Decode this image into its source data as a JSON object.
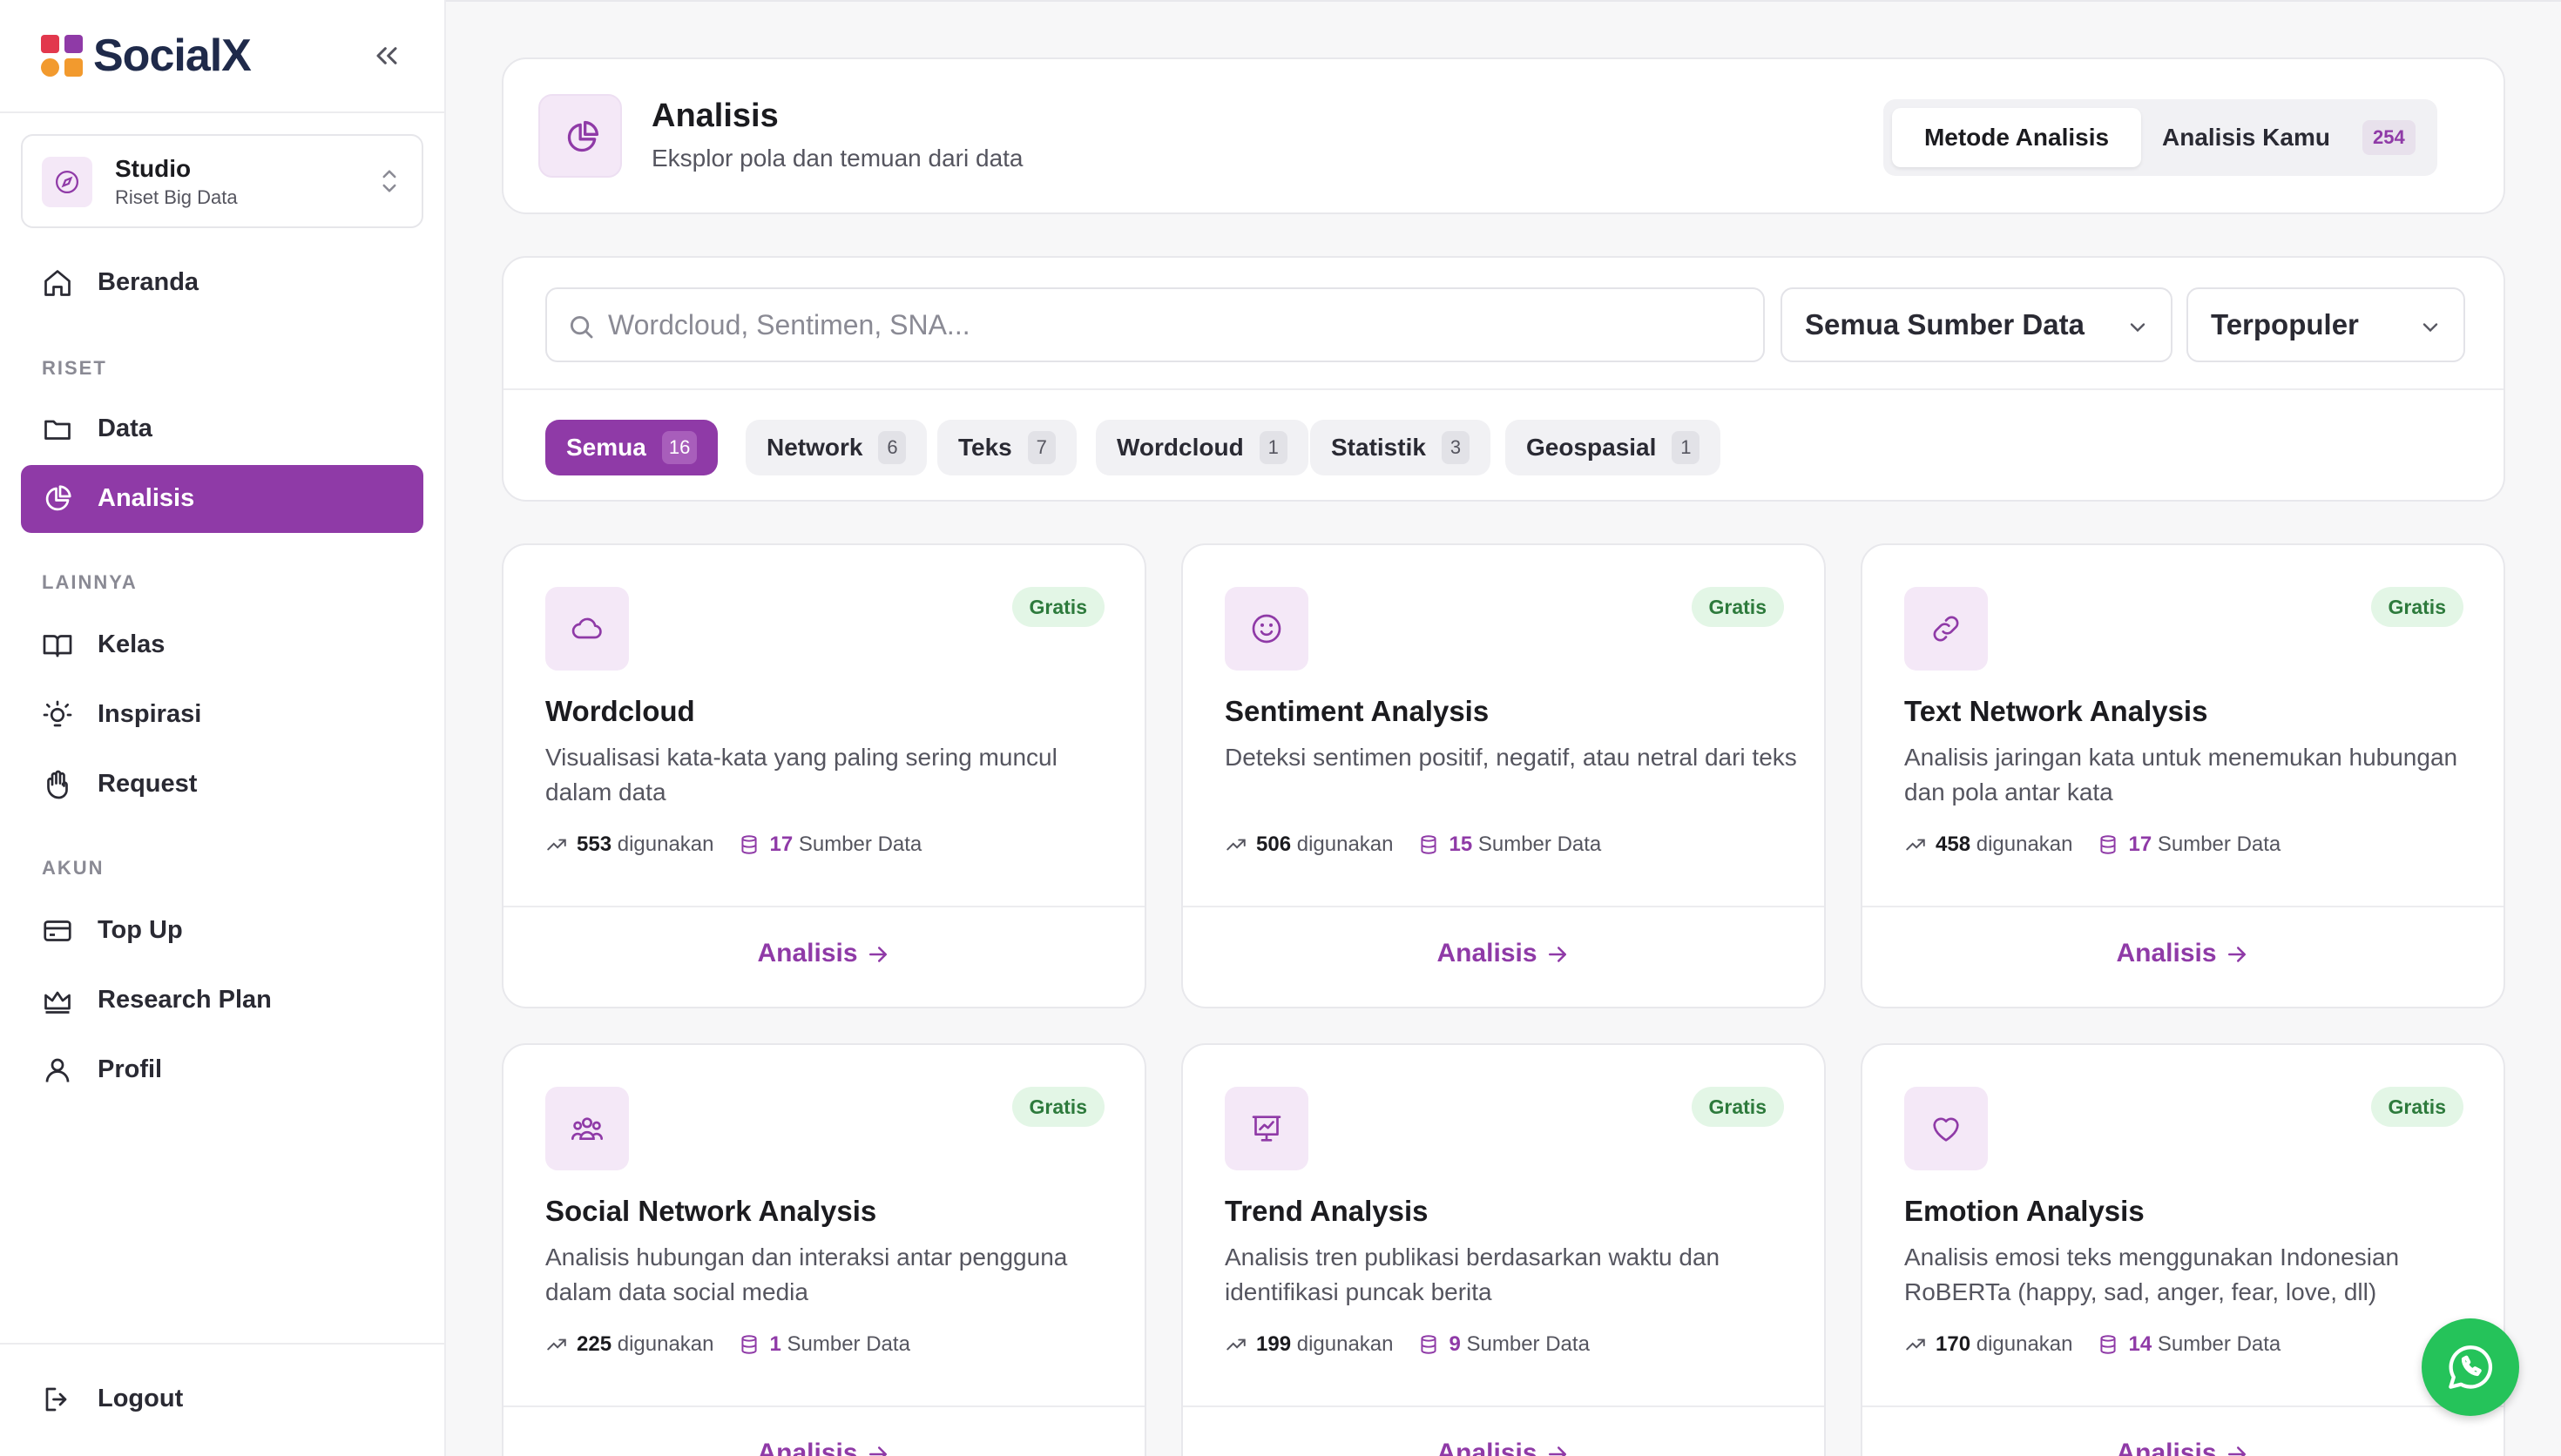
{
  "app": {
    "name": "SocialX"
  },
  "workspace": {
    "name": "Studio",
    "subtitle": "Riset Big Data"
  },
  "sidebar": {
    "home": "Beranda",
    "sections": {
      "riset": "RISET",
      "lainnya": "LAINNYA",
      "akun": "AKUN"
    },
    "items": {
      "data": "Data",
      "analisis": "Analisis",
      "kelas": "Kelas",
      "inspirasi": "Inspirasi",
      "request": "Request",
      "topup": "Top Up",
      "research_plan": "Research Plan",
      "profil": "Profil"
    },
    "logout": "Logout",
    "active": "analisis"
  },
  "header": {
    "title": "Analisis",
    "subtitle": "Eksplor pola dan temuan dari data",
    "tab_methods": "Metode Analisis",
    "tab_mine": "Analisis Kamu",
    "tab_mine_count": "254"
  },
  "filters": {
    "search_placeholder": "Wordcloud, Sentimen, SNA...",
    "source_select": "Semua Sumber Data",
    "sort_select": "Terpopuler",
    "chips": [
      {
        "label": "Semua",
        "count": "16"
      },
      {
        "label": "Network",
        "count": "6"
      },
      {
        "label": "Teks",
        "count": "7"
      },
      {
        "label": "Wordcloud",
        "count": "1"
      },
      {
        "label": "Statistik",
        "count": "3"
      },
      {
        "label": "Geospasial",
        "count": "1"
      }
    ]
  },
  "cards": [
    {
      "icon": "cloud-icon",
      "badge": "Gratis",
      "title": "Wordcloud",
      "desc": "Visualisasi kata-kata yang paling sering muncul dalam data",
      "used": "553",
      "used_label": "digunakan",
      "sources": "17",
      "sources_label": "Sumber Data",
      "action": "Analisis"
    },
    {
      "icon": "smile-icon",
      "badge": "Gratis",
      "title": "Sentiment Analysis",
      "desc": "Deteksi sentimen positif, negatif, atau netral dari teks",
      "used": "506",
      "used_label": "digunakan",
      "sources": "15",
      "sources_label": "Sumber Data",
      "action": "Analisis"
    },
    {
      "icon": "link-icon",
      "badge": "Gratis",
      "title": "Text Network Analysis",
      "desc": "Analisis jaringan kata untuk menemukan hubungan dan pola antar kata",
      "used": "458",
      "used_label": "digunakan",
      "sources": "17",
      "sources_label": "Sumber Data",
      "action": "Analisis"
    },
    {
      "icon": "users-icon",
      "badge": "Gratis",
      "title": "Social Network Analysis",
      "desc": "Analisis hubungan dan interaksi antar pengguna dalam data social media",
      "used": "225",
      "used_label": "digunakan",
      "sources": "1",
      "sources_label": "Sumber Data",
      "action": "Analisis"
    },
    {
      "icon": "presentation-chart-icon",
      "badge": "Gratis",
      "title": "Trend Analysis",
      "desc": "Analisis tren publikasi berdasarkan waktu dan identifikasi puncak berita",
      "used": "199",
      "used_label": "digunakan",
      "sources": "9",
      "sources_label": "Sumber Data",
      "action": "Analisis"
    },
    {
      "icon": "heart-icon",
      "badge": "Gratis",
      "title": "Emotion Analysis",
      "desc": "Analisis emosi teks menggunakan Indonesian RoBERTa (happy, sad, anger, fear, love, dll)",
      "used": "170",
      "used_label": "digunakan",
      "sources": "14",
      "sources_label": "Sumber Data",
      "action": "Analisis"
    }
  ],
  "colors": {
    "accent": "#8f3aa7",
    "badge_bg": "#e3f6e6",
    "badge_fg": "#2d7a3c",
    "whatsapp": "#25c35a"
  }
}
